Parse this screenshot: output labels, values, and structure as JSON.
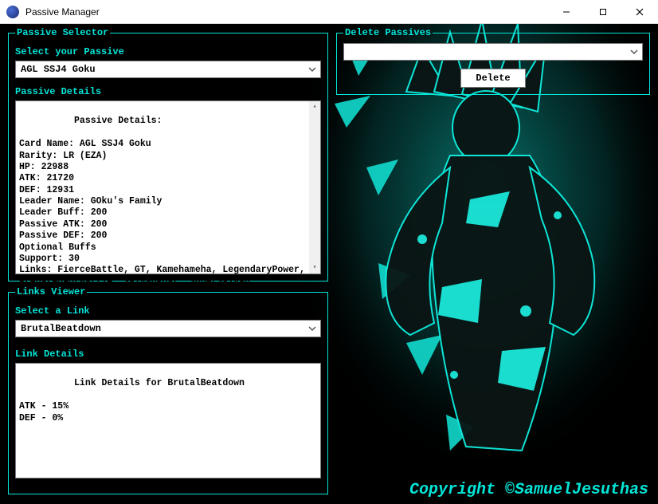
{
  "window": {
    "title": "Passive Manager"
  },
  "passive_selector": {
    "legend": "Passive Selector",
    "label": "Select your Passive",
    "selected": "AGL SSJ4 Goku"
  },
  "passive_details": {
    "label": "Passive Details",
    "text": "Passive Details:\n\nCard Name: AGL SSJ4 Goku\nRarity: LR (EZA)\nHP: 22988\nATK: 21720\nDEF: 12931\nLeader Name: GOku's Family\nLeader Buff: 200\nPassive ATK: 200\nPassive DEF: 200\nOptional Buffs\nSupport: 30\nLinks: FierceBattle, GT, Kamehameha, LegendaryPower, PreparedForBattle, SaiyanRoar, SuperSaiyan"
  },
  "links_viewer": {
    "legend": "Links Viewer",
    "label": "Select a Link",
    "selected": "BrutalBeatdown"
  },
  "link_details": {
    "label": "Link Details",
    "text": "Link Details for BrutalBeatdown\n\nATK - 15%\nDEF - 0%"
  },
  "delete_passives": {
    "legend": "Delete Passives",
    "selected": "",
    "button": "Delete"
  },
  "footer": {
    "copyright": "Copyright ©SamuelJesuthas"
  },
  "colors": {
    "accent": "#00e5d8",
    "bg": "#000000"
  }
}
